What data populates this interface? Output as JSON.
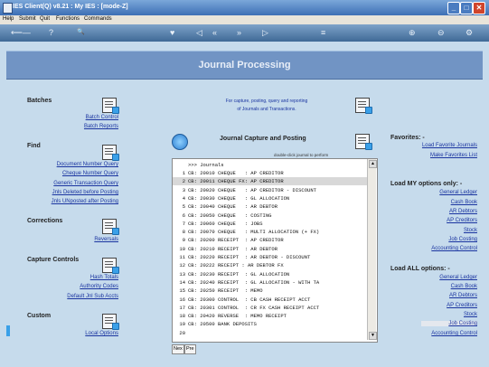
{
  "window": {
    "title": "IES Client(Q) v8.21 : My IES :       [mode-Z]",
    "min_glyph": "_",
    "max_glyph": "□",
    "close_glyph": "✕"
  },
  "menu": {
    "items": [
      "Help",
      "Submit",
      "Quit",
      "Functions",
      "Commands"
    ]
  },
  "toolbar": {
    "glyphs": [
      "⟵—",
      "?",
      "🔍",
      "♥",
      "◁",
      "«",
      "»",
      "▷",
      "≡",
      "⊕",
      "⊖",
      "⚙"
    ]
  },
  "banner": {
    "title": "Journal Processing"
  },
  "left": {
    "batches": {
      "title": "Batches",
      "links": [
        "Batch Control",
        "Batch Reports"
      ]
    },
    "find": {
      "title": "Find",
      "links": [
        "Document Number Query",
        "Cheque Number Query",
        "Generic Transaction Query",
        "Jnls Deleted before Posting",
        "Jnls UNposted after Posting"
      ]
    },
    "corrections": {
      "title": "Corrections",
      "links": [
        "Reversals"
      ]
    },
    "capture": {
      "title": "Capture Controls",
      "links": [
        "Hash Totals",
        "Authority Codes",
        "Default Jnl Sub Accts"
      ]
    },
    "custom": {
      "title": "Custom",
      "links": [
        "Local Options"
      ]
    }
  },
  "center": {
    "info_line1": "For capture, posting, query and reporting",
    "info_line2": "of Journals and Transactions.",
    "capture_title": "Journal Capture and Posting",
    "hint": "double-click journal to perform",
    "list_header": ">>> Journals",
    "rows": [
      {
        "n": "1",
        "t": "CB: 20010 CHEQUE   : AP CREDITOR"
      },
      {
        "n": "2",
        "t": "CB: 20011 CHEQUE FX: AP CREDITOR"
      },
      {
        "n": "3",
        "t": "CB: 20020 CHEQUE   : AP CREDITOR - DISCOUNT"
      },
      {
        "n": "4",
        "t": "CB: 20030 CHEQUE   : GL ALLOCATION"
      },
      {
        "n": "5",
        "t": "CB: 20040 CHEQUE   : AR DEBTOR"
      },
      {
        "n": "6",
        "t": "CB: 20050 CHEQUE   : COSTING"
      },
      {
        "n": "7",
        "t": "CB: 20060 CHEQUE   : JOBS"
      },
      {
        "n": "8",
        "t": "CB: 20070 CHEQUE   : MULTI ALLOCATION (+ FX)"
      },
      {
        "n": "9",
        "t": "CB: 20200 RECEIPT  : AP CREDITOR"
      },
      {
        "n": "10",
        "t": "CB: 20210 RECEIPT  : AR DEBTOR"
      },
      {
        "n": "11",
        "t": "CB: 20220 RECEIPT  : AR DEBTOR - DISCOUNT"
      },
      {
        "n": "12",
        "t": "CB: 20222 RECEIPT : AR DEBTOR FX"
      },
      {
        "n": "13",
        "t": "CB: 20230 RECEIPT  : GL ALLOCATION"
      },
      {
        "n": "14",
        "t": "CB: 20240 RECEIPT  : GL ALLOCATION - WITH TA"
      },
      {
        "n": "15",
        "t": "CB: 20250 RECEIPT  : MEMO"
      },
      {
        "n": "16",
        "t": "CB: 20300 CONTROL  : CB CASH RECEIPT ACCT"
      },
      {
        "n": "17",
        "t": "CB: 20301 CONTROL  : CR FX CASH RECEIPT ACCT"
      },
      {
        "n": "18",
        "t": "CB: 20420 REVERSE  : MEMO RECEIPT"
      },
      {
        "n": "19",
        "t": "CB: 20500 BANK DEPOSITS"
      },
      {
        "n": "20",
        "t": ""
      }
    ],
    "tabs": [
      "Nex",
      "Pre"
    ]
  },
  "right": {
    "favorites": {
      "title": "Favorites: -",
      "links": [
        "Load Favorite Journals",
        "Make Favorites List"
      ]
    },
    "load_my": {
      "title": "Load MY options only: -",
      "links": [
        "General Ledger",
        "Cash Book",
        "AR Debtors",
        "AP Creditors",
        "Stock",
        "Job Costing",
        "Accounting Control"
      ]
    },
    "load_all": {
      "title": "Load ALL options: -",
      "links": [
        "General Ledger",
        "Cash Book",
        "AR Debtors",
        "AP Creditors",
        "Stock",
        "Job Costing",
        "Accounting Control"
      ]
    }
  }
}
